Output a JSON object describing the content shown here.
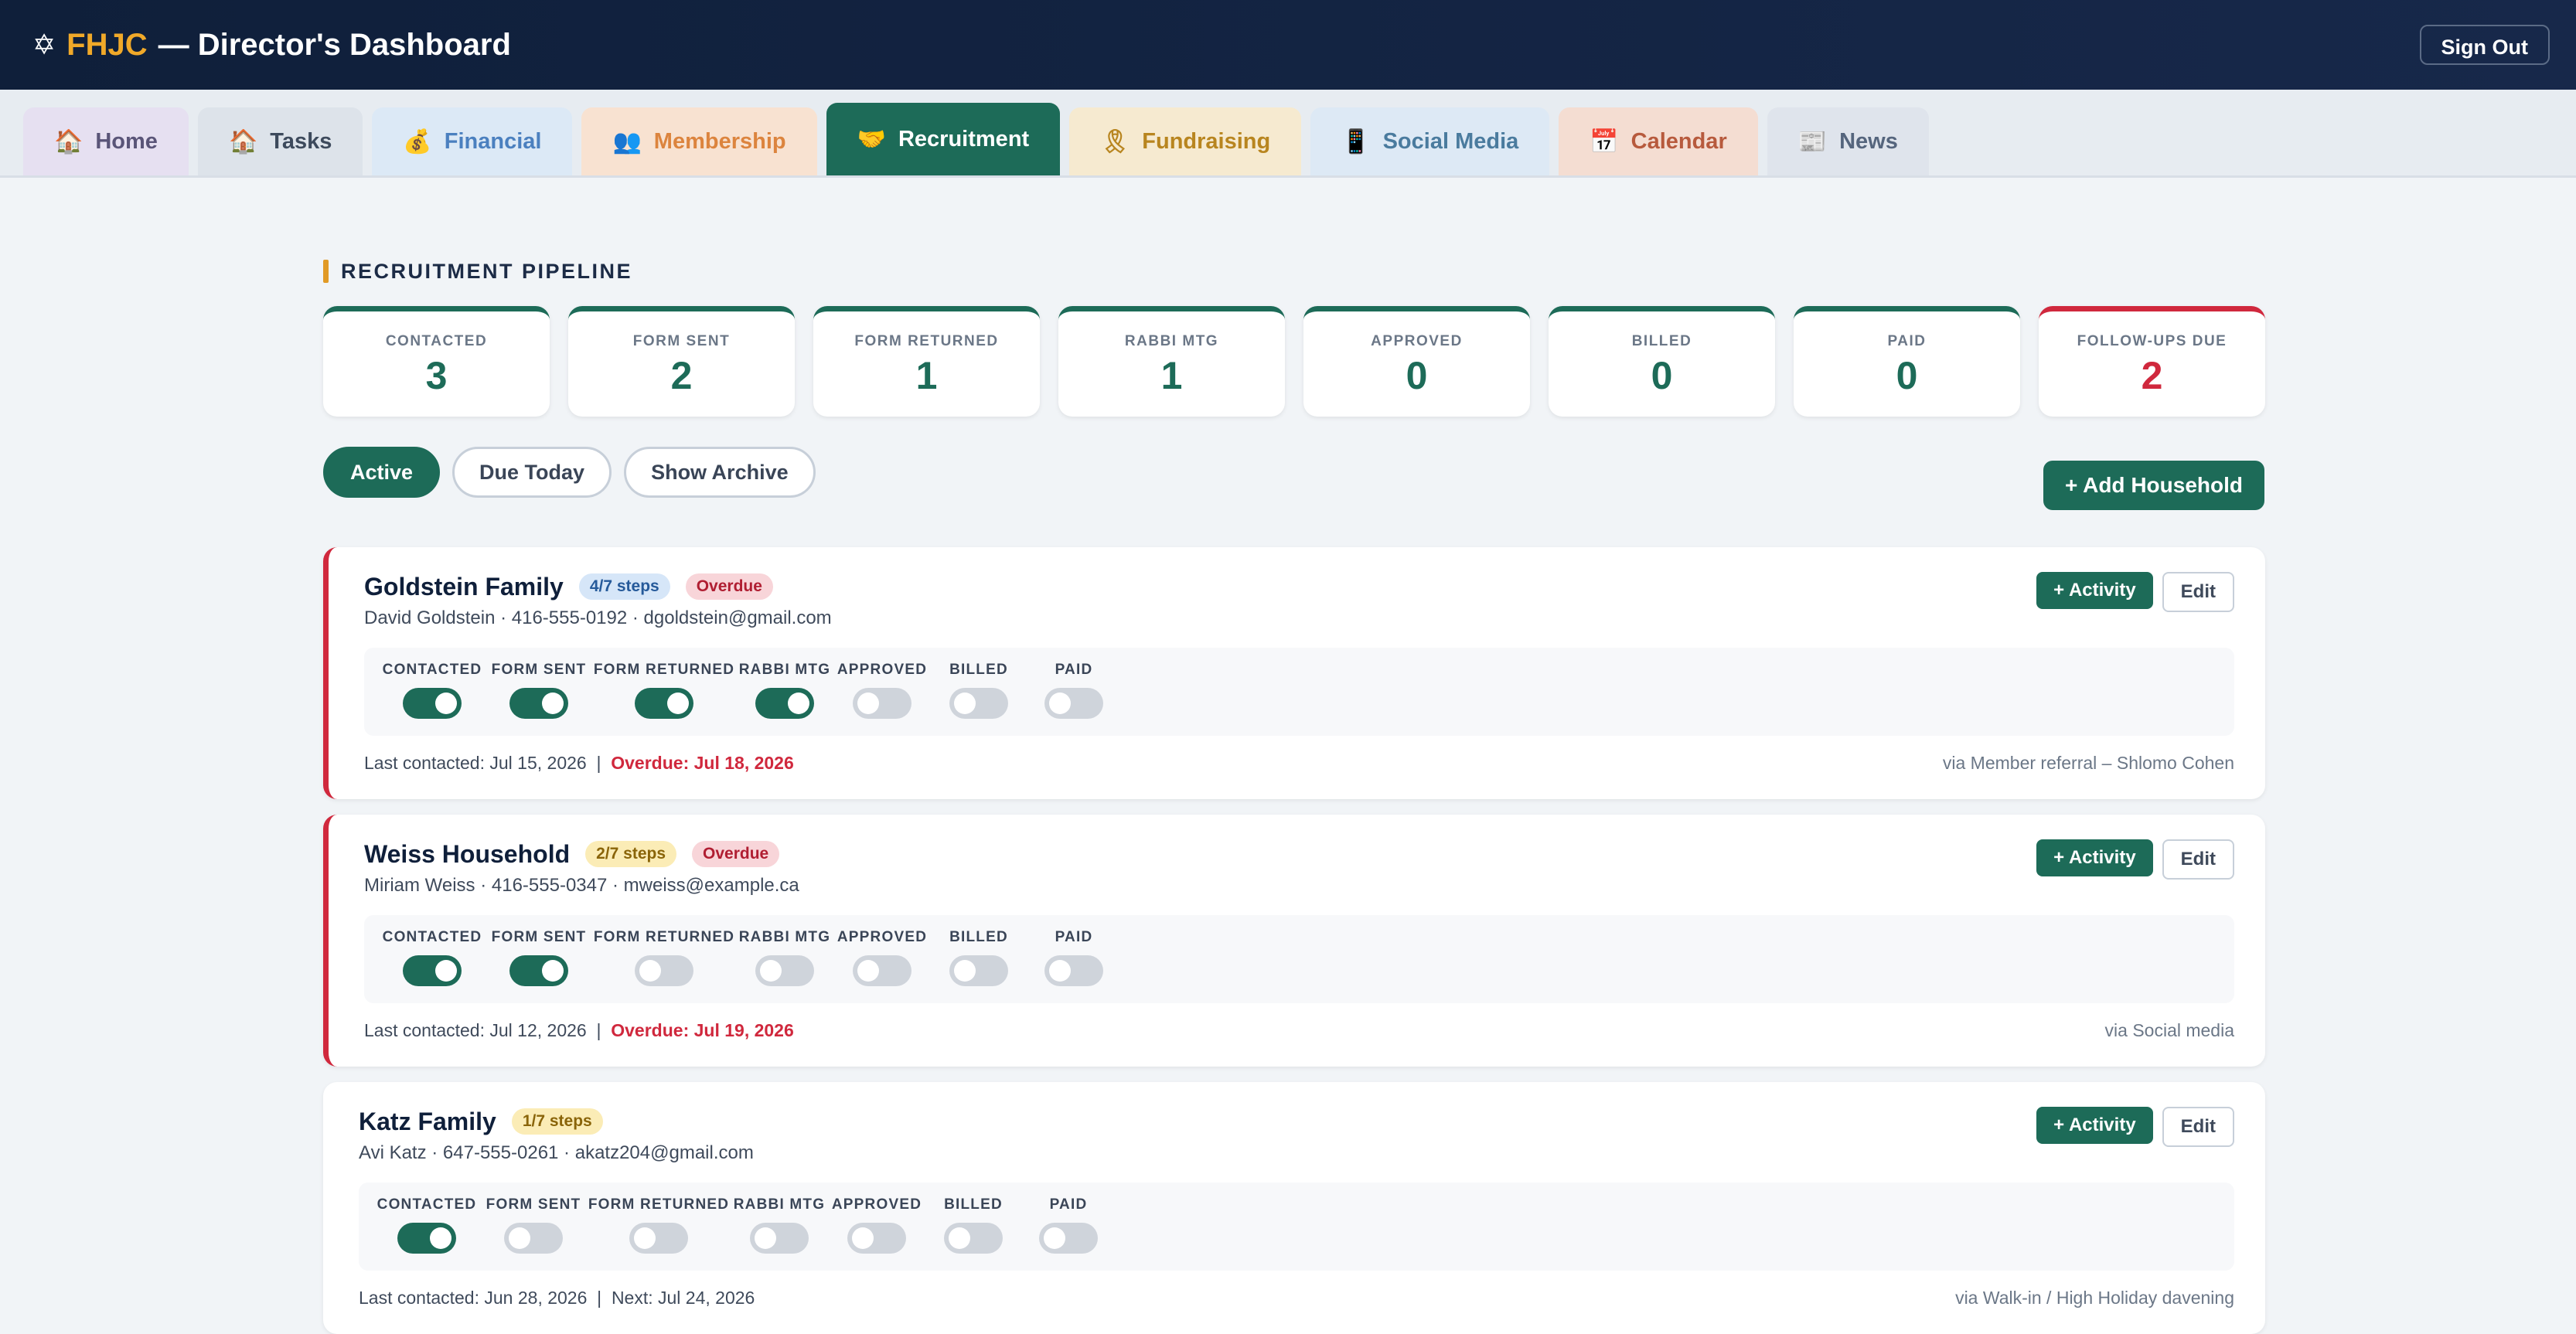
{
  "header": {
    "star": "✡",
    "org": "FHJC",
    "title": "— Director's Dashboard",
    "signout": "Sign Out"
  },
  "tabs": [
    {
      "icon": "🏠",
      "label": "Home"
    },
    {
      "icon": "🏠",
      "label": "Tasks"
    },
    {
      "icon": "💰",
      "label": "Financial"
    },
    {
      "icon": "👥",
      "label": "Membership"
    },
    {
      "icon": "🤝",
      "label": "Recruitment"
    },
    {
      "icon": "🎗",
      "label": "Fundraising"
    },
    {
      "icon": "📱",
      "label": "Social Media"
    },
    {
      "icon": "📅",
      "label": "Calendar"
    },
    {
      "icon": "📰",
      "label": "News"
    }
  ],
  "pipeline": {
    "title": "RECRUITMENT PIPELINE",
    "stats": [
      {
        "label": "CONTACTED",
        "value": "3"
      },
      {
        "label": "FORM SENT",
        "value": "2"
      },
      {
        "label": "FORM RETURNED",
        "value": "1"
      },
      {
        "label": "RABBI MTG",
        "value": "1"
      },
      {
        "label": "APPROVED",
        "value": "0"
      },
      {
        "label": "BILLED",
        "value": "0"
      },
      {
        "label": "PAID",
        "value": "0"
      },
      {
        "label": "FOLLOW-UPS DUE",
        "value": "2"
      }
    ]
  },
  "filters": [
    "Active",
    "Due Today",
    "Show Archive"
  ],
  "add_household": "+ Add Household",
  "step_labels": [
    "CONTACTED",
    "FORM SENT",
    "FORM RETURNED",
    "RABBI MTG",
    "APPROVED",
    "BILLED",
    "PAID"
  ],
  "card_actions": {
    "activity": "+ Activity",
    "edit": "Edit"
  },
  "households": [
    {
      "name": "Goldstein Family",
      "steps_badge": "4/7 steps",
      "overdue_badge": "Overdue",
      "contact": "David Goldstein · 416-555-0192 · dgoldstein@gmail.com",
      "steps_done": [
        true,
        true,
        true,
        true,
        false,
        false,
        false
      ],
      "last_contacted": "Last contacted: Jul 15, 2026",
      "sep": "|",
      "next": "Overdue: Jul 18, 2026",
      "source": "via Member referral – Shlomo Cohen"
    },
    {
      "name": "Weiss Household",
      "steps_badge": "2/7 steps",
      "overdue_badge": "Overdue",
      "contact": "Miriam Weiss · 416-555-0347 · mweiss@example.ca",
      "steps_done": [
        true,
        true,
        false,
        false,
        false,
        false,
        false
      ],
      "last_contacted": "Last contacted: Jul 12, 2026",
      "sep": "|",
      "next": "Overdue: Jul 19, 2026",
      "source": "via Social media"
    },
    {
      "name": "Katz Family",
      "steps_badge": "1/7 steps",
      "overdue_badge": "",
      "contact": "Avi Katz · 647-555-0261 · akatz204@gmail.com",
      "steps_done": [
        true,
        false,
        false,
        false,
        false,
        false,
        false
      ],
      "last_contacted": "Last contacted: Jun 28, 2026",
      "sep": "|",
      "next": "Next: Jul 24, 2026",
      "source": "via Walk-in / High Holiday davening"
    }
  ]
}
